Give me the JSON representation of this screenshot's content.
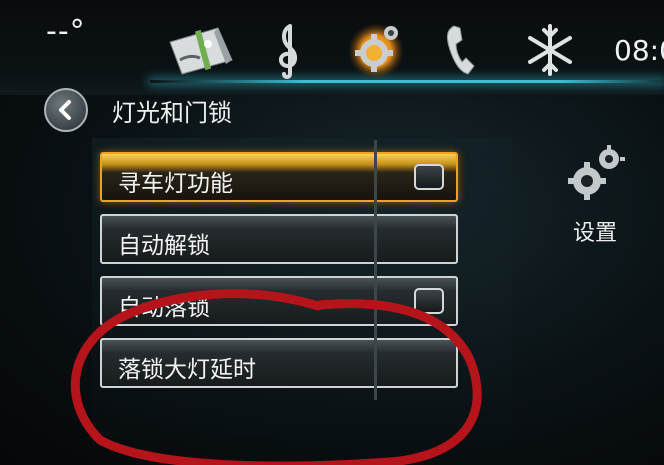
{
  "status_bar": {
    "temperature": "--°",
    "clock": "08:0"
  },
  "nav": {
    "items": [
      {
        "name": "navigation",
        "icon": "map-icon"
      },
      {
        "name": "music",
        "icon": "treble-clef-icon"
      },
      {
        "name": "settings",
        "icon": "gear-icon",
        "active": true
      },
      {
        "name": "phone",
        "icon": "phone-icon"
      },
      {
        "name": "climate",
        "icon": "snowflake-icon"
      }
    ]
  },
  "page": {
    "title": "灯光和门锁",
    "back_icon": "back-arrow-icon"
  },
  "settings_list": {
    "items": [
      {
        "label": "寻车灯功能",
        "has_checkbox": true,
        "checked": false,
        "selected": true
      },
      {
        "label": "自动解锁",
        "has_checkbox": false
      },
      {
        "label": "自动落锁",
        "has_checkbox": true,
        "checked": false
      },
      {
        "label": "落锁大灯延时",
        "has_checkbox": false
      }
    ]
  },
  "side_panel": {
    "label": "设置",
    "icon": "gears-icon"
  },
  "colors": {
    "accent_glow": "#3cd2e6",
    "selected_border": "#f2a11c",
    "annotation": "#b5141a"
  }
}
